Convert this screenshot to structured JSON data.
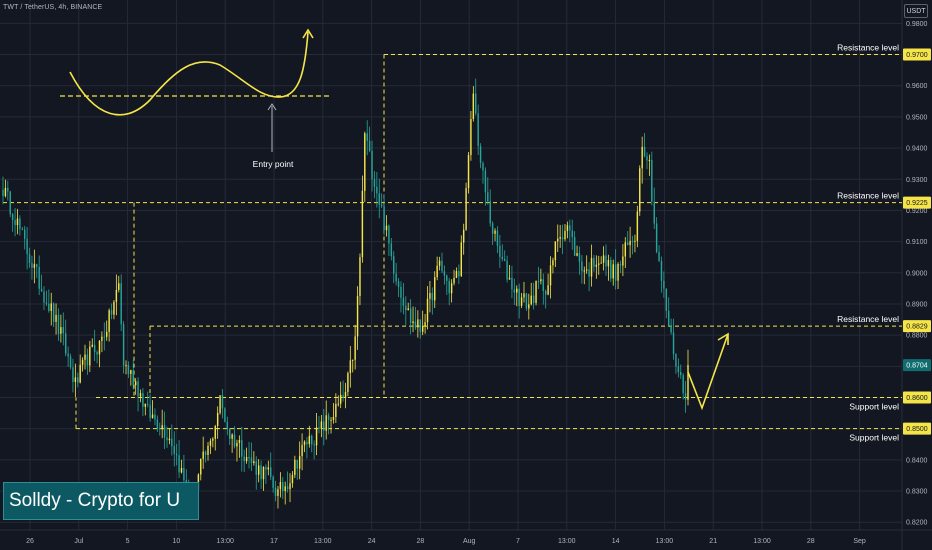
{
  "header": {
    "title": "TWT / TetherUS, 4h, BINANCE"
  },
  "currency_label": "USDT",
  "watermark": "Solldy - Crypto for U",
  "colors": {
    "background": "#131722",
    "grid": "#262a36",
    "bull": "#f5e548",
    "bear": "#26a69a",
    "level_line": "#f5e548",
    "axis_text": "#b2b5be",
    "current_price_tag": "#0f6d6f"
  },
  "chart_data": {
    "type": "candlestick",
    "ylim": [
      0.8175,
      0.9875
    ],
    "y_ticks": [
      "0.9800",
      "0.9700",
      "0.9600",
      "0.9500",
      "0.9400",
      "0.9300",
      "0.9200",
      "0.9100",
      "0.9000",
      "0.8900",
      "0.8800",
      "0.8700",
      "0.8600",
      "0.8500",
      "0.8400",
      "0.8300",
      "0.8200"
    ],
    "x_ticks": [
      "26",
      "Jul",
      "5",
      "10",
      "13:00",
      "17",
      "13:00",
      "24",
      "28",
      "Aug",
      "7",
      "13:00",
      "14",
      "13:00",
      "21",
      "13:00",
      "28",
      "Sep"
    ],
    "levels": [
      {
        "label": "Resistance level",
        "price": 0.97,
        "price_label": "0.9700"
      },
      {
        "label": "Resistance level",
        "price": 0.9225,
        "price_label": "0.9225"
      },
      {
        "label": "Resistance level",
        "price": 0.8829,
        "price_label": "0.8829"
      },
      {
        "label": "Support level",
        "price": 0.86,
        "price_label": "0.8600"
      },
      {
        "label": "Support level",
        "price": 0.85,
        "price_label": "0.8500"
      }
    ],
    "current_price": {
      "price": 0.8704,
      "label": "0.8704"
    },
    "annotation": {
      "label": "Entry point"
    },
    "anchors": [
      [
        0,
        0.927
      ],
      [
        5,
        0.918
      ],
      [
        10,
        0.907
      ],
      [
        16,
        0.895
      ],
      [
        20,
        0.888
      ],
      [
        25,
        0.878
      ],
      [
        30,
        0.864
      ],
      [
        35,
        0.873
      ],
      [
        40,
        0.877
      ],
      [
        44,
        0.885
      ],
      [
        48,
        0.896
      ],
      [
        50,
        0.871
      ],
      [
        55,
        0.865
      ],
      [
        60,
        0.855
      ],
      [
        65,
        0.852
      ],
      [
        70,
        0.846
      ],
      [
        74,
        0.836
      ],
      [
        78,
        0.824
      ],
      [
        82,
        0.838
      ],
      [
        86,
        0.845
      ],
      [
        90,
        0.859
      ],
      [
        94,
        0.848
      ],
      [
        98,
        0.845
      ],
      [
        102,
        0.84
      ],
      [
        106,
        0.837
      ],
      [
        110,
        0.835
      ],
      [
        114,
        0.829
      ],
      [
        118,
        0.833
      ],
      [
        122,
        0.84
      ],
      [
        126,
        0.846
      ],
      [
        130,
        0.848
      ],
      [
        134,
        0.852
      ],
      [
        138,
        0.856
      ],
      [
        142,
        0.861
      ],
      [
        146,
        0.878
      ],
      [
        148,
        0.905
      ],
      [
        150,
        0.945
      ],
      [
        153,
        0.933
      ],
      [
        157,
        0.92
      ],
      [
        161,
        0.905
      ],
      [
        165,
        0.894
      ],
      [
        169,
        0.885
      ],
      [
        173,
        0.882
      ],
      [
        177,
        0.891
      ],
      [
        181,
        0.903
      ],
      [
        185,
        0.895
      ],
      [
        189,
        0.9
      ],
      [
        192,
        0.925
      ],
      [
        195,
        0.958
      ],
      [
        198,
        0.935
      ],
      [
        202,
        0.917
      ],
      [
        206,
        0.905
      ],
      [
        210,
        0.898
      ],
      [
        214,
        0.892
      ],
      [
        218,
        0.89
      ],
      [
        222,
        0.896
      ],
      [
        226,
        0.896
      ],
      [
        230,
        0.912
      ],
      [
        234,
        0.915
      ],
      [
        238,
        0.905
      ],
      [
        242,
        0.9
      ],
      [
        246,
        0.905
      ],
      [
        250,
        0.903
      ],
      [
        254,
        0.899
      ],
      [
        258,
        0.907
      ],
      [
        262,
        0.912
      ],
      [
        265,
        0.943
      ],
      [
        268,
        0.935
      ],
      [
        271,
        0.907
      ],
      [
        274,
        0.893
      ],
      [
        277,
        0.879
      ],
      [
        280,
        0.868
      ],
      [
        283,
        0.862
      ],
      [
        284,
        0.8704
      ]
    ],
    "candle_count": 285
  }
}
